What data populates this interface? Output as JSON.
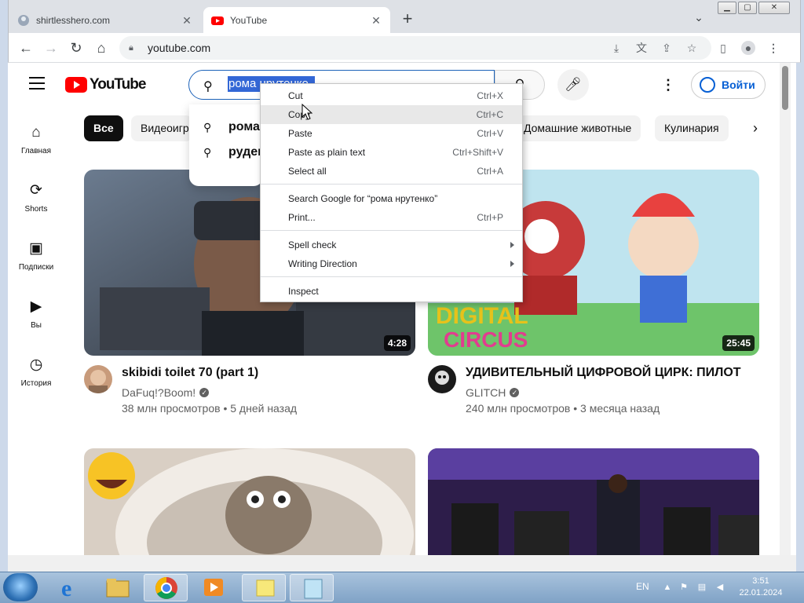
{
  "browser": {
    "tabs": [
      {
        "title": "shirtlesshero.com",
        "active": false
      },
      {
        "title": "YouTube",
        "active": true
      }
    ],
    "new_tab": "+",
    "url": "youtube.com"
  },
  "youtube": {
    "logo_text": "YouTube",
    "search": {
      "query": "рома нрутенко"
    },
    "signin_label": "Войти",
    "sidebar": [
      {
        "label": "Главная",
        "icon": "home-icon"
      },
      {
        "label": "Shorts",
        "icon": "shorts-icon"
      },
      {
        "label": "Подписки",
        "icon": "subscriptions-icon"
      },
      {
        "label": "Вы",
        "icon": "library-icon"
      },
      {
        "label": "История",
        "icon": "history-icon"
      }
    ],
    "chips": [
      "Все",
      "Видеоигры",
      "Домашние животные",
      "Кулинария"
    ],
    "suggestions": [
      "рома",
      "руден"
    ],
    "videos": [
      {
        "title": "skibidi toilet 70 (part 1)",
        "channel": "DaFuq!?Boom!",
        "views": "38 млн просмотров",
        "age": "5 дней назад",
        "duration": "4:28"
      },
      {
        "title": "УДИВИТЕЛЬНЫЙ ЦИФРОВОЙ ЦИРК: ПИЛОТ",
        "channel": "GLITCH",
        "views": "240 млн просмотров",
        "age": "3 месяца назад",
        "duration": "25:45"
      }
    ],
    "thumb_text": {
      "digital": "DIGITAL",
      "circus": "CIRCUS"
    },
    "meta_sep": "•"
  },
  "context_menu": {
    "items": [
      {
        "label": "Cut",
        "shortcut": "Ctrl+X"
      },
      {
        "label": "Copy",
        "shortcut": "Ctrl+C"
      },
      {
        "label": "Paste",
        "shortcut": "Ctrl+V"
      },
      {
        "label": "Paste as plain text",
        "shortcut": "Ctrl+Shift+V"
      },
      {
        "label": "Select all",
        "shortcut": "Ctrl+A"
      },
      {
        "label": "Search Google for “рома нрутенко”",
        "shortcut": ""
      },
      {
        "label": "Print...",
        "shortcut": "Ctrl+P"
      },
      {
        "label": "Spell check",
        "shortcut": ""
      },
      {
        "label": "Writing Direction",
        "shortcut": ""
      },
      {
        "label": "Inspect",
        "shortcut": ""
      }
    ]
  },
  "taskbar": {
    "language": "EN",
    "time": "3:51",
    "date": "22.01.2024"
  },
  "colors": {
    "youtube_red": "#ff0000",
    "link_blue": "#065fd4",
    "selection": "#3367d6"
  }
}
